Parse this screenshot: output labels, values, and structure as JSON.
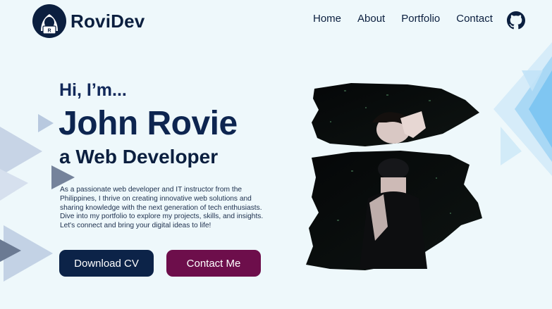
{
  "brand": {
    "name": "RoviDev",
    "logo_icon": "hooded-developer-laptop-icon"
  },
  "nav": {
    "items": [
      {
        "label": "Home"
      },
      {
        "label": "About"
      },
      {
        "label": "Portfolio"
      },
      {
        "label": "Contact"
      }
    ],
    "github_icon": "github-icon"
  },
  "hero": {
    "greeting": "Hi, I’m...",
    "name": "John Rovie",
    "role": "a Web Developer",
    "bio": "As a passionate web developer and IT instructor from the Philippines, I thrive on creating innovative web solutions and sharing knowledge with the next generation of tech enthusiasts. Dive into my portfolio to explore my projects, skills, and insights. Let's connect and bring your digital ideas to life!",
    "buttons": {
      "download_cv": "Download CV",
      "contact_me": "Contact Me"
    }
  },
  "colors": {
    "background": "#eef8fb",
    "navy": "#0c2348",
    "plum": "#6d0e4b",
    "accent_blue": "#7fc6f2"
  }
}
